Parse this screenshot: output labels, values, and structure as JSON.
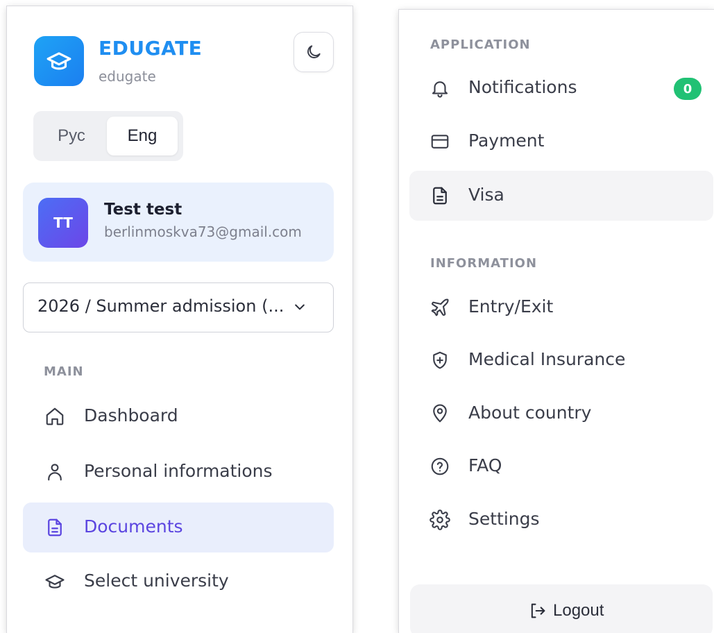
{
  "brand": {
    "name": "EDUGATE",
    "subtitle": "edugate",
    "logo_icon": "graduation-cap-icon",
    "accent": "#1f8ef1"
  },
  "theme_toggle": {
    "icon": "moon-icon"
  },
  "language": {
    "options": [
      "Рус",
      "Eng"
    ],
    "selected": "Eng"
  },
  "user": {
    "initials": "TT",
    "name": "Test test",
    "email": "berlinmoskva73@gmail.com"
  },
  "admission_select": {
    "value": "2026 / Summer admission (...",
    "icon": "chevron-down-icon"
  },
  "sidebar": {
    "main_label": "MAIN",
    "items": [
      {
        "label": "Dashboard",
        "icon": "home-icon",
        "active": false
      },
      {
        "label": "Personal informations",
        "icon": "user-icon",
        "active": false
      },
      {
        "label": "Documents",
        "icon": "document-icon",
        "active": true
      },
      {
        "label": "Select university",
        "icon": "graduation-cap-icon",
        "active": false
      }
    ]
  },
  "right_menu": {
    "application_label": "APPLICATION",
    "application_items": [
      {
        "label": "Notifications",
        "icon": "bell-icon",
        "badge": "0"
      },
      {
        "label": "Payment",
        "icon": "credit-card-icon"
      },
      {
        "label": "Visa",
        "icon": "document-icon",
        "selected": true
      }
    ],
    "information_label": "INFORMATION",
    "information_items": [
      {
        "label": "Entry/Exit",
        "icon": "airplane-icon"
      },
      {
        "label": "Medical Insurance",
        "icon": "shield-plus-icon"
      },
      {
        "label": "About country",
        "icon": "map-pin-icon"
      },
      {
        "label": "FAQ",
        "icon": "help-circle-icon"
      },
      {
        "label": "Settings",
        "icon": "gear-icon"
      }
    ],
    "logout_label": "Logout",
    "logout_icon": "logout-icon"
  },
  "colors": {
    "active_bg": "#e9eefc",
    "active_text": "#5b45e0",
    "badge": "#21c174",
    "user_card_bg": "#eaf1fd"
  }
}
